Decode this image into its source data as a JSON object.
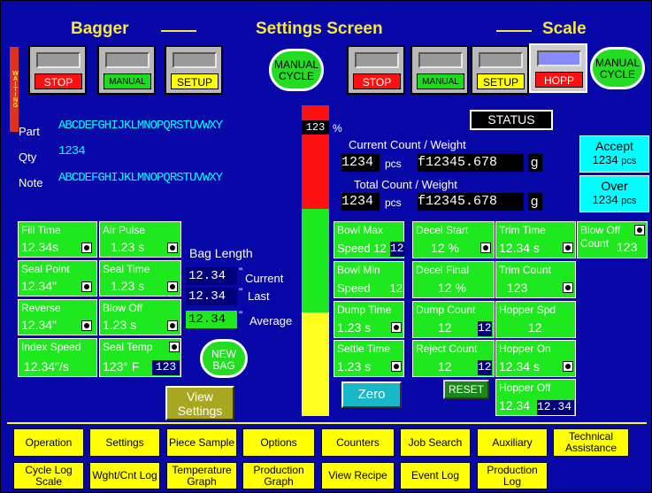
{
  "header": {
    "left": "Bagger",
    "center": "Settings Screen",
    "right": "Scale"
  },
  "waiting": "WAITING",
  "bagger_controls": {
    "stop": "STOP",
    "manual": "MANUAL",
    "setup": "SETUP",
    "manual_cycle": "MANUAL CYCLE"
  },
  "scale_controls": {
    "stop": "STOP",
    "manual": "MANUAL",
    "setup": "SETUP",
    "hopp": "HOPP",
    "manual_cycle": "MANUAL CYCLE"
  },
  "job": {
    "part_label": "Part",
    "part_value": "ABCDEFGHIJKLMNOPQRSTUVWXY",
    "qty_label": "Qty",
    "qty_value": "1234",
    "note_label": "Note",
    "note_value": "ABCDEFGHIJKLMNOPQRSTUVWXY"
  },
  "progress": {
    "value": "123",
    "unit": "%"
  },
  "status_label": "STATUS",
  "counts": {
    "current_label": "Current Count / Weight",
    "current_pcs": "1234",
    "pcs": "pcs",
    "current_weight": "f12345.678",
    "g": "g",
    "total_label": "Total Count / Weight",
    "total_pcs": "1234",
    "total_weight": "f12345.678"
  },
  "accept": {
    "label": "Accept",
    "value": "1234",
    "unit": "pcs"
  },
  "over": {
    "label": "Over",
    "value": "1234",
    "unit": "pcs"
  },
  "bagger_settings": {
    "fill_time": {
      "label": "Fill Time",
      "value": "12.34s"
    },
    "air_pulse": {
      "label": "Air Pulse",
      "value": "1.23 s"
    },
    "seal_point": {
      "label": "Seal Point",
      "value": "12.34\""
    },
    "seal_time": {
      "label": "Seal Time",
      "value": "1.23 s"
    },
    "reverse": {
      "label": "Reverse",
      "value": "12.34\""
    },
    "blow_off": {
      "label": "Blow Off",
      "value": "1.23 s"
    },
    "index_speed": {
      "label": "Index Speed",
      "value": "12.34\"/s"
    },
    "seal_temp": {
      "label": "Seal Temp",
      "value": "123° F",
      "set": "123"
    }
  },
  "bag_length": {
    "title": "Bag Length",
    "current": "12.34",
    "current_label": "Current",
    "last": "12.34",
    "last_label": "Last",
    "average": "12.34",
    "average_label": "Average",
    "inch": "\""
  },
  "new_bag": "NEW BAG",
  "view_settings": "View Settings",
  "scale_settings": {
    "bowl_max": {
      "label": "Bowl Max",
      "sub": "Speed",
      "value": "12",
      "set": "12"
    },
    "decel_start": {
      "label": "Decel Start",
      "value": "12 %"
    },
    "trim_time": {
      "label": "Trim Time",
      "value": "12.34 s"
    },
    "blow_off_count": {
      "label": "Blow Off",
      "sub": "Count",
      "value": "123"
    },
    "bowl_min": {
      "label": "Bowl Min",
      "sub": "Speed",
      "value": "12"
    },
    "decel_final": {
      "label": "Decel Final",
      "value": "12 %"
    },
    "trim_count": {
      "label": "Trim Count",
      "value": "123"
    },
    "dump_time": {
      "label": "Dump Time",
      "value": "1.23 s"
    },
    "dump_count": {
      "label": "Dump Count",
      "value": "12",
      "set": "12"
    },
    "hopper_spd": {
      "label": "Hopper Spd",
      "value": "12"
    },
    "settle_time": {
      "label": "Settle Time",
      "value": "1.23 s"
    },
    "reject_count": {
      "label": "Reject Count",
      "value": "12",
      "set": "12"
    },
    "hopper_on": {
      "label": "Hopper On",
      "value": "12.34 s"
    },
    "hopper_off": {
      "label": "Hopper Off",
      "value": "12.34",
      "set": "12.34"
    }
  },
  "zero": "Zero",
  "reset": "RESET",
  "nav_row1": [
    "Operation",
    "Settings",
    "Piece Sample",
    "Options",
    "Counters",
    "Job Search",
    "Auxiliary",
    "Technical Assistance"
  ],
  "nav_row2": [
    "Cycle Log Scale",
    "Wght/Cnt Log",
    "Temperature Graph",
    "Production Graph",
    "View Recipe",
    "Event Log",
    "Production Log"
  ],
  "colors": {
    "background": "#0808a8",
    "header": "#f5e642",
    "green": "#1ee81e",
    "cyan": "#00ffff",
    "nav": "#ffff00"
  }
}
